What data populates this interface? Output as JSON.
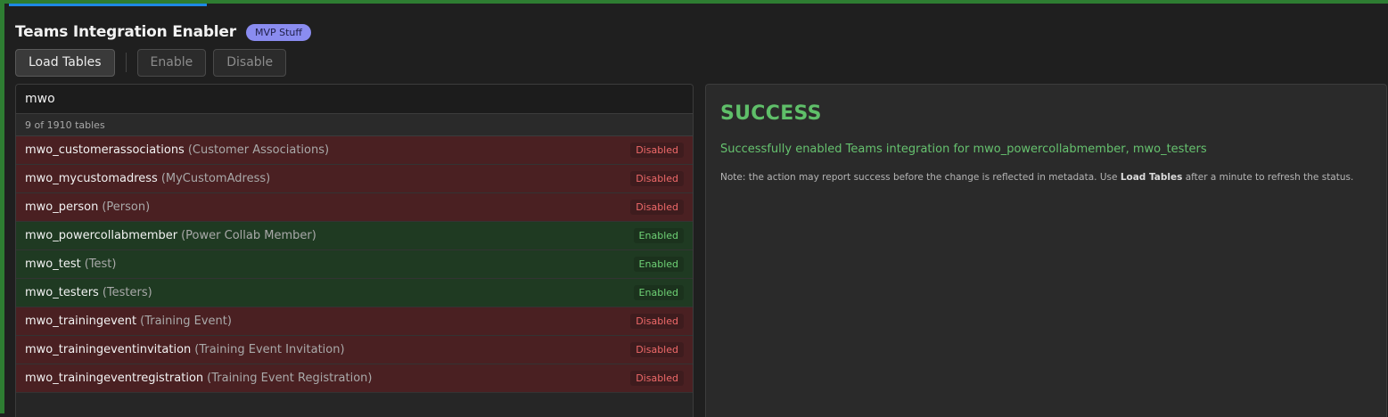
{
  "app": {
    "title": "Teams Integration Enabler",
    "badge": "MVP Stuff"
  },
  "toolbar": {
    "load_label": "Load Tables",
    "enable_label": "Enable",
    "disable_label": "Disable"
  },
  "search": {
    "value": "mwo",
    "placeholder": ""
  },
  "table_count": "9 of 1910 tables",
  "rows": [
    {
      "name": "mwo_customerassociations",
      "display": "(Customer Associations)",
      "status": "Disabled"
    },
    {
      "name": "mwo_mycustomadress",
      "display": "(MyCustomAdress)",
      "status": "Disabled"
    },
    {
      "name": "mwo_person",
      "display": "(Person)",
      "status": "Disabled"
    },
    {
      "name": "mwo_powercollabmember",
      "display": "(Power Collab Member)",
      "status": "Enabled"
    },
    {
      "name": "mwo_test",
      "display": "(Test)",
      "status": "Enabled"
    },
    {
      "name": "mwo_testers",
      "display": "(Testers)",
      "status": "Enabled"
    },
    {
      "name": "mwo_trainingevent",
      "display": "(Training Event)",
      "status": "Disabled"
    },
    {
      "name": "mwo_trainingeventinvitation",
      "display": "(Training Event Invitation)",
      "status": "Disabled"
    },
    {
      "name": "mwo_trainingeventregistration",
      "display": "(Training Event Registration)",
      "status": "Disabled"
    }
  ],
  "result": {
    "title": "SUCCESS",
    "message": "Successfully enabled Teams integration for mwo_powercollabmember, mwo_testers",
    "note_prefix": "Note: the action may report success before the change is reflected in metadata. Use",
    "note_bold": "Load Tables",
    "note_suffix": "after a minute to refresh the status."
  },
  "colors": {
    "accent_green": "#2e7d32",
    "success": "#5fbf69",
    "disabled_row": "#4a2022",
    "enabled_row": "#1f3a22",
    "badge": "#8a8cf0"
  }
}
